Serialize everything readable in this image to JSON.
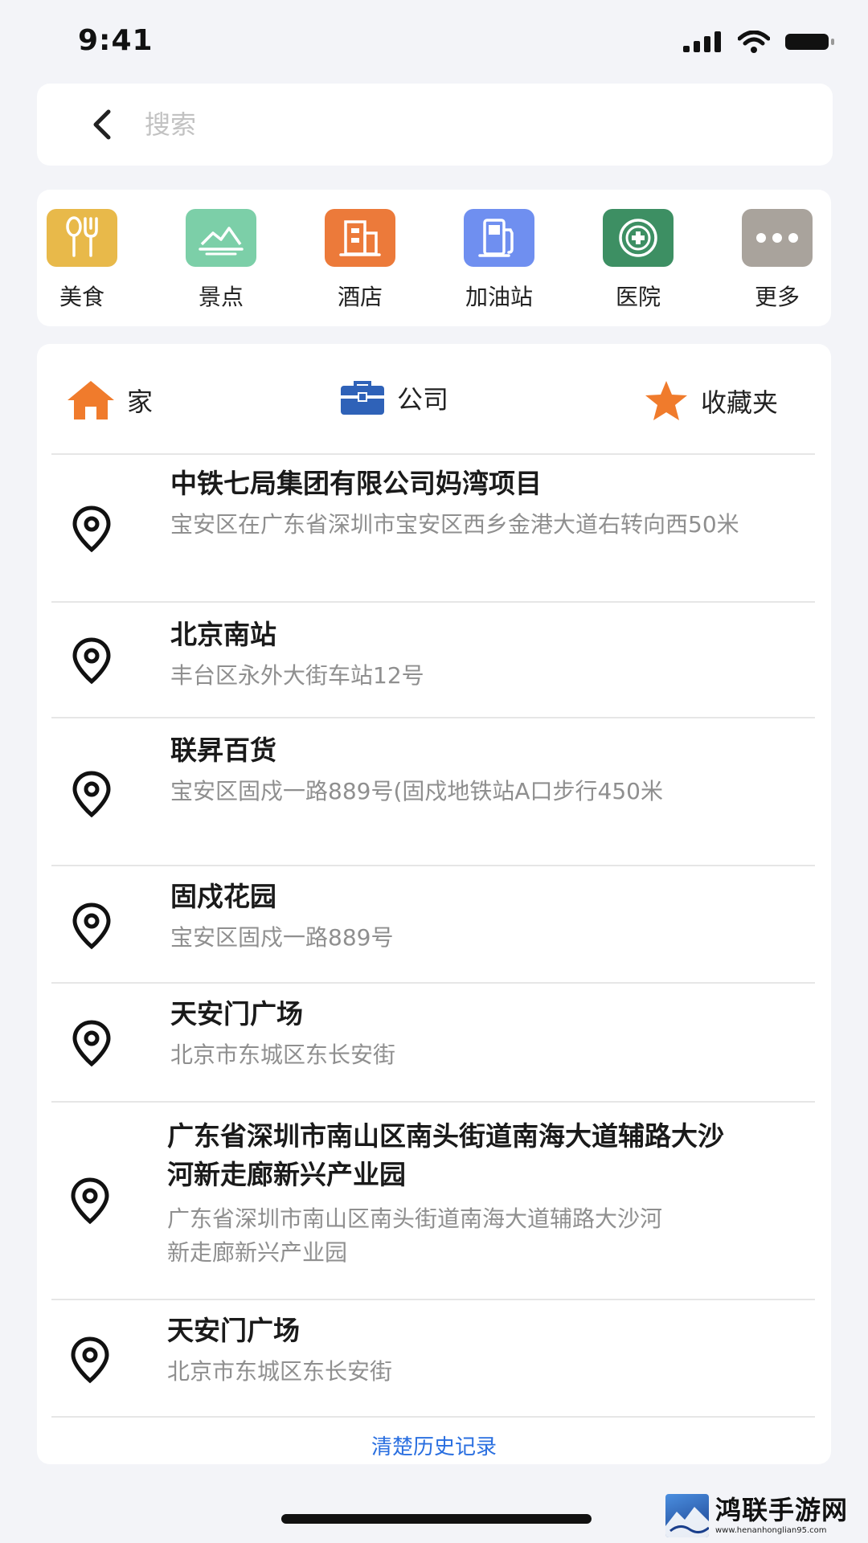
{
  "status_bar": {
    "time": "9:41"
  },
  "search": {
    "placeholder": "搜索"
  },
  "categories": [
    {
      "label": "美食",
      "icon": "fork-knife-icon",
      "color": "#e8b94a"
    },
    {
      "label": "景点",
      "icon": "mountain-icon",
      "color": "#7ccfa8"
    },
    {
      "label": "酒店",
      "icon": "building-icon",
      "color": "#ec7a3a"
    },
    {
      "label": "加油站",
      "icon": "gas-pump-icon",
      "color": "#6f8ff0"
    },
    {
      "label": "医院",
      "icon": "medical-cross-icon",
      "color": "#3d8f63"
    },
    {
      "label": "更多",
      "icon": "more-dots-icon",
      "color": "#a9a39c"
    }
  ],
  "shortcuts": {
    "home": "家",
    "company": "公司",
    "favorites": "收藏夹"
  },
  "history": [
    {
      "title": "中铁七局集团有限公司妈湾项目",
      "subtitle": "宝安区在广东省深圳市宝安区西乡金港大道右转向西50米"
    },
    {
      "title": "北京南站",
      "subtitle": "丰台区永外大街车站12号"
    },
    {
      "title": "联昇百货",
      "subtitle": "宝安区固戍一路889号(固戍地铁站A口步行450米"
    },
    {
      "title": "固戍花园",
      "subtitle": "宝安区固戍一路889号"
    },
    {
      "title": "天安门广场",
      "subtitle": "北京市东城区东长安街"
    },
    {
      "title": "广东省深圳市南山区南头街道南海大道辅路大沙河新走廊新兴产业园",
      "subtitle": "广东省深圳市南山区南头街道南海大道辅路大沙河新走廊新兴产业园"
    },
    {
      "title": "天安门广场",
      "subtitle": "北京市东城区东长安街"
    }
  ],
  "clear_history_label": "清楚历史记录",
  "watermark": {
    "title": "鸿联手游网",
    "url": "www.henanhonglian95.com"
  },
  "colors": {
    "accent_orange": "#f07b2c",
    "company_blue": "#2f62b8",
    "link_blue": "#2a6fe0"
  }
}
